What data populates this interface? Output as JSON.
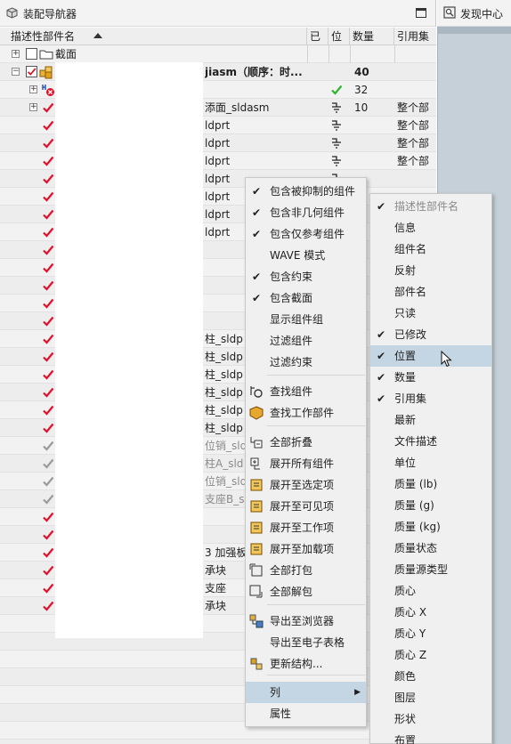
{
  "panel": {
    "title": "装配导航器",
    "side_tab_label": "发现中心"
  },
  "columns": [
    {
      "label": "描述性部件名"
    },
    {
      "label": "已"
    },
    {
      "label": "位"
    },
    {
      "label": "数量"
    },
    {
      "label": "引用集"
    }
  ],
  "tree": {
    "section_label": "截面",
    "rows": [
      {
        "name": "jiasm（顺序：时...",
        "qty": "40",
        "ref": "",
        "tick": "red",
        "pos": ""
      },
      {
        "name": "",
        "qty": "32",
        "ref": "",
        "tick": "none",
        "pos": "check"
      },
      {
        "name": "添面_sldasm",
        "qty": "10",
        "ref": "整个部",
        "tick": "red",
        "pos": "ground"
      },
      {
        "name": "ldprt",
        "qty": "",
        "ref": "整个部",
        "tick": "red",
        "pos": "ground"
      },
      {
        "name": "ldprt",
        "qty": "",
        "ref": "整个部",
        "tick": "red",
        "pos": "ground"
      },
      {
        "name": "ldprt",
        "qty": "",
        "ref": "整个部",
        "tick": "red",
        "pos": "ground"
      },
      {
        "name": "ldprt",
        "qty": "",
        "ref": "",
        "tick": "red",
        "pos": "ground"
      },
      {
        "name": "ldprt",
        "qty": "",
        "ref": "",
        "tick": "red",
        "pos": ""
      },
      {
        "name": "ldprt",
        "qty": "",
        "ref": "",
        "tick": "red",
        "pos": ""
      },
      {
        "name": "ldprt",
        "qty": "",
        "ref": "",
        "tick": "red",
        "pos": ""
      },
      {
        "name": "",
        "qty": "",
        "ref": "",
        "tick": "red",
        "pos": ""
      },
      {
        "name": "",
        "qty": "",
        "ref": "",
        "tick": "red",
        "pos": ""
      },
      {
        "name": "",
        "qty": "",
        "ref": "",
        "tick": "red",
        "pos": ""
      },
      {
        "name": "",
        "qty": "",
        "ref": "",
        "tick": "red",
        "pos": ""
      },
      {
        "name": "",
        "qty": "",
        "ref": "",
        "tick": "red",
        "pos": ""
      },
      {
        "name": "柱_sldp",
        "qty": "",
        "ref": "",
        "tick": "red",
        "pos": ""
      },
      {
        "name": "柱_sldp",
        "qty": "",
        "ref": "",
        "tick": "red",
        "pos": ""
      },
      {
        "name": "柱_sldp",
        "qty": "",
        "ref": "",
        "tick": "red",
        "pos": ""
      },
      {
        "name": "柱_sldp",
        "qty": "",
        "ref": "",
        "tick": "red",
        "pos": ""
      },
      {
        "name": "柱_sldp",
        "qty": "",
        "ref": "",
        "tick": "red",
        "pos": ""
      },
      {
        "name": "柱_sldp",
        "qty": "",
        "ref": "",
        "tick": "red",
        "pos": ""
      },
      {
        "name": "位销_sld",
        "qty": "",
        "ref": "",
        "tick": "gray",
        "pos": ""
      },
      {
        "name": "柱A_sld",
        "qty": "",
        "ref": "",
        "tick": "gray",
        "pos": ""
      },
      {
        "name": "位销_sld",
        "qty": "",
        "ref": "",
        "tick": "gray",
        "pos": ""
      },
      {
        "name": "支座B_s",
        "qty": "",
        "ref": "",
        "tick": "gray",
        "pos": ""
      },
      {
        "name": "",
        "qty": "",
        "ref": "",
        "tick": "red",
        "pos": ""
      },
      {
        "name": "",
        "qty": "",
        "ref": "",
        "tick": "red",
        "pos": ""
      },
      {
        "name": "3 加强板",
        "qty": "",
        "ref": "",
        "tick": "red",
        "pos": ""
      },
      {
        "name": "承块",
        "qty": "",
        "ref": "",
        "tick": "red",
        "pos": ""
      },
      {
        "name": "支座",
        "qty": "",
        "ref": "",
        "tick": "red",
        "pos": ""
      },
      {
        "name": "承块",
        "qty": "",
        "ref": "",
        "tick": "red",
        "pos": ""
      }
    ]
  },
  "context_menu": {
    "items": [
      {
        "label": "包含被抑制的组件",
        "checked": true,
        "icon": ""
      },
      {
        "label": "包含非几何组件",
        "checked": true,
        "icon": ""
      },
      {
        "label": "包含仅参考组件",
        "checked": true,
        "icon": ""
      },
      {
        "label": "WAVE 模式",
        "checked": false,
        "icon": ""
      },
      {
        "label": "包含约束",
        "checked": true,
        "icon": ""
      },
      {
        "label": "包含截面",
        "checked": true,
        "icon": ""
      },
      {
        "label": "显示组件组",
        "checked": false,
        "icon": ""
      },
      {
        "label": "过滤组件",
        "checked": false,
        "icon": ""
      },
      {
        "label": "过滤约束",
        "checked": false,
        "icon": ""
      },
      {
        "label": "查找组件",
        "checked": false,
        "icon": "find-component-icon"
      },
      {
        "label": "查找工作部件",
        "checked": false,
        "icon": "find-work-part-icon"
      },
      {
        "label": "全部折叠",
        "checked": false,
        "icon": "collapse-all-icon"
      },
      {
        "label": "展开所有组件",
        "checked": false,
        "icon": "expand-all-icon"
      },
      {
        "label": "展开至选定项",
        "checked": false,
        "icon": "expand-to-selected-icon"
      },
      {
        "label": "展开至可见项",
        "checked": false,
        "icon": "expand-to-visible-icon"
      },
      {
        "label": "展开至工作项",
        "checked": false,
        "icon": "expand-to-work-icon"
      },
      {
        "label": "展开至加载项",
        "checked": false,
        "icon": "expand-to-loaded-icon"
      },
      {
        "label": "全部打包",
        "checked": false,
        "icon": "pack-all-icon"
      },
      {
        "label": "全部解包",
        "checked": false,
        "icon": "unpack-all-icon"
      },
      {
        "label": "导出至浏览器",
        "checked": false,
        "icon": "export-browser-icon"
      },
      {
        "label": "导出至电子表格",
        "checked": false,
        "icon": ""
      },
      {
        "label": "更新结构...",
        "checked": false,
        "icon": "update-structure-icon"
      },
      {
        "label": "列",
        "checked": false,
        "icon": ""
      },
      {
        "label": "属性",
        "checked": false,
        "icon": ""
      }
    ]
  },
  "columns_submenu": {
    "items": [
      {
        "label": "描述性部件名",
        "checked": true,
        "disabled": true
      },
      {
        "label": "信息",
        "checked": false
      },
      {
        "label": "组件名",
        "checked": false
      },
      {
        "label": "反射",
        "checked": false
      },
      {
        "label": "部件名",
        "checked": false
      },
      {
        "label": "只读",
        "checked": false
      },
      {
        "label": "已修改",
        "checked": true
      },
      {
        "label": "位置",
        "checked": true
      },
      {
        "label": "数量",
        "checked": true
      },
      {
        "label": "引用集",
        "checked": true
      },
      {
        "label": "最新",
        "checked": false
      },
      {
        "label": "文件描述",
        "checked": false
      },
      {
        "label": "单位",
        "checked": false
      },
      {
        "label": "质量 (lb)",
        "checked": false
      },
      {
        "label": "质量 (g)",
        "checked": false
      },
      {
        "label": "质量 (kg)",
        "checked": false
      },
      {
        "label": "质量状态",
        "checked": false
      },
      {
        "label": "质量源类型",
        "checked": false
      },
      {
        "label": "质心",
        "checked": false
      },
      {
        "label": "质心 X",
        "checked": false
      },
      {
        "label": "质心 Y",
        "checked": false
      },
      {
        "label": "质心 Z",
        "checked": false
      },
      {
        "label": "颜色",
        "checked": false
      },
      {
        "label": "图层",
        "checked": false
      },
      {
        "label": "形状",
        "checked": false
      },
      {
        "label": "布置",
        "checked": false
      }
    ]
  },
  "colors": {
    "red_check": "#e0102a",
    "green_check": "#2bb52b",
    "gray_check": "#9a9a9a",
    "highlight": "#c4d6e3"
  }
}
